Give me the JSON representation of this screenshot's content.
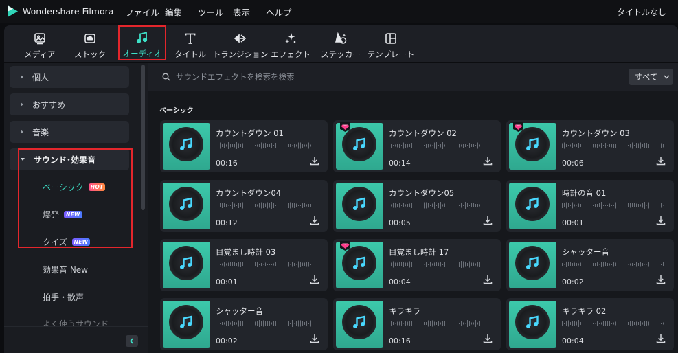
{
  "app": {
    "name": "Wondershare Filmora",
    "menus": [
      "ファイル",
      "編集",
      "ツール",
      "表示",
      "ヘルプ"
    ],
    "doc_title": "タイトルなし"
  },
  "toolbar": {
    "items": [
      {
        "label": "メディア",
        "icon": "media-icon"
      },
      {
        "label": "ストック",
        "icon": "stock-cloud-icon"
      },
      {
        "label": "オーディオ",
        "icon": "music-note-icon",
        "active": true
      },
      {
        "label": "タイトル",
        "icon": "title-t-icon"
      },
      {
        "label": "トランジション",
        "icon": "transition-icon"
      },
      {
        "label": "エフェクト",
        "icon": "effects-sparkle-icon"
      },
      {
        "label": "ステッカー",
        "icon": "sticker-icon"
      },
      {
        "label": "テンプレート",
        "icon": "template-icon"
      }
    ]
  },
  "sidebar": {
    "categories": [
      "個人",
      "おすすめ",
      "音楽",
      "サウンド･効果音"
    ],
    "subitems": [
      {
        "label": "ベーシック",
        "badge": "HOT"
      },
      {
        "label": "爆発",
        "badge": "NEW"
      },
      {
        "label": "クイズ",
        "badge": "NEW"
      }
    ],
    "more": [
      "効果音 New",
      "拍手・歓声",
      "よく使うサウンド"
    ]
  },
  "search": {
    "placeholder": "サウンドエフェクトを検索を検索",
    "filter": "すべて"
  },
  "section": {
    "title": "ベーシック"
  },
  "sounds": [
    {
      "name": "カウントダウン 01",
      "duration": "00:16",
      "premium": false
    },
    {
      "name": "カウントダウン 02",
      "duration": "00:14",
      "premium": true
    },
    {
      "name": "カウントダウン 03",
      "duration": "00:06",
      "premium": true
    },
    {
      "name": "カウントダウン04",
      "duration": "00:12",
      "premium": false
    },
    {
      "name": "カウントダウン05",
      "duration": "00:05",
      "premium": false
    },
    {
      "name": "時計の音 01",
      "duration": "00:01",
      "premium": false
    },
    {
      "name": "目覚まし時計 03",
      "duration": "00:01",
      "premium": false
    },
    {
      "name": "目覚まし時計 17",
      "duration": "00:04",
      "premium": true
    },
    {
      "name": "シャッター音",
      "duration": "00:02",
      "premium": false
    },
    {
      "name": "シャッター音",
      "duration": "00:02",
      "premium": false
    },
    {
      "name": "キラキラ",
      "duration": "00:16",
      "premium": false
    },
    {
      "name": "キラキラ 02",
      "duration": "00:04",
      "premium": false
    }
  ],
  "colors": {
    "accent": "#3de0c7",
    "highlight_box": "#e3262c",
    "thumb": "#3cc9ab"
  }
}
